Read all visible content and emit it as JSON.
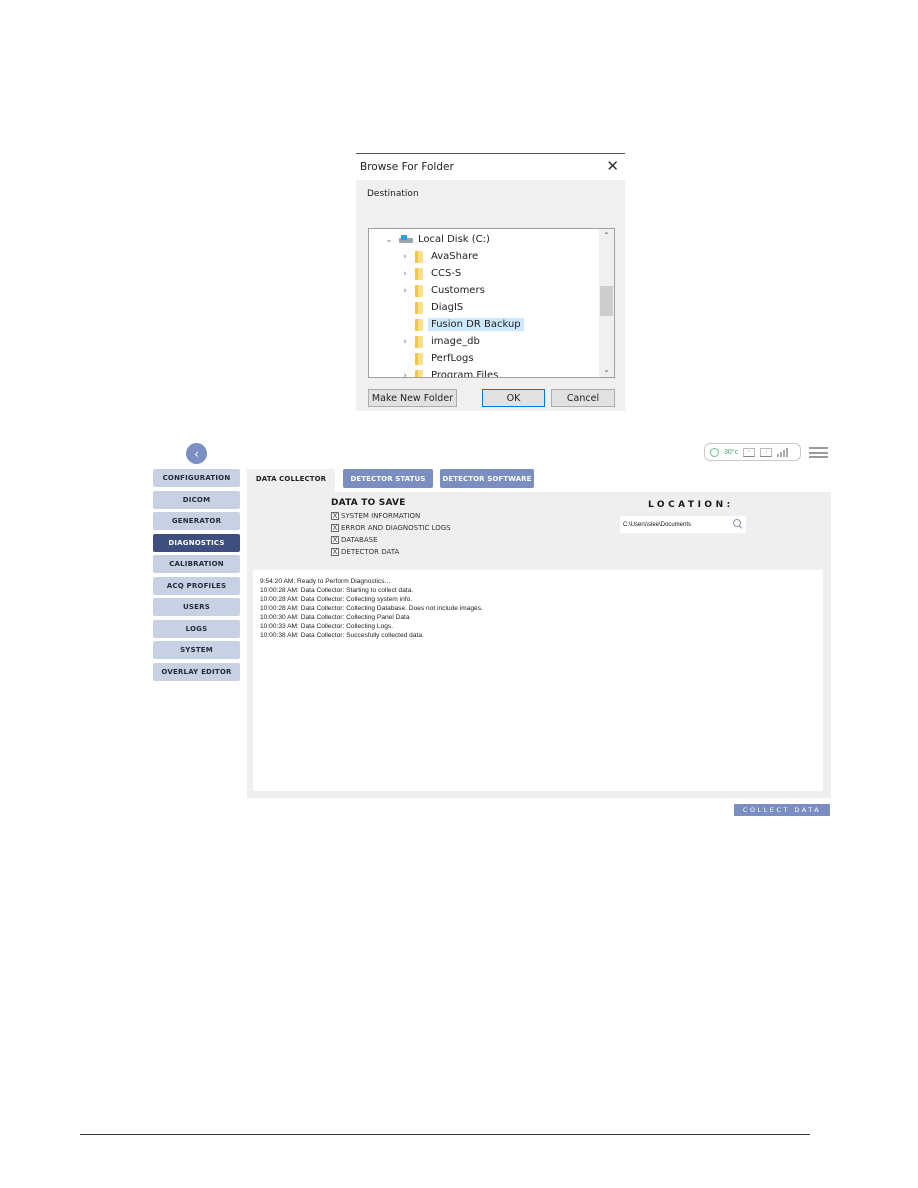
{
  "dialog": {
    "title": "Browse For Folder",
    "close_icon": "close-icon",
    "destination_label": "Destination",
    "tree": {
      "root": {
        "label": "Local Disk (C:)",
        "icon": "drive-icon",
        "expanded": true
      },
      "items": [
        {
          "label": "AvaShare",
          "expandable": true,
          "selected": false
        },
        {
          "label": "CCS-S",
          "expandable": true,
          "selected": false
        },
        {
          "label": "Customers",
          "expandable": true,
          "selected": false
        },
        {
          "label": "DiagIS",
          "expandable": false,
          "selected": false
        },
        {
          "label": "Fusion DR Backup",
          "expandable": false,
          "selected": true
        },
        {
          "label": "image_db",
          "expandable": true,
          "selected": false
        },
        {
          "label": "PerfLogs",
          "expandable": false,
          "selected": false
        },
        {
          "label": "Program Files",
          "expandable": true,
          "selected": false
        }
      ]
    },
    "buttons": {
      "make_new_folder": "Make New Folder",
      "ok": "OK",
      "cancel": "Cancel"
    }
  },
  "app": {
    "status": {
      "temperature": "30°c",
      "icons": [
        "status-ring-icon",
        "panel-icon",
        "download-icon",
        "signal-icon"
      ]
    },
    "sidebar": {
      "items": [
        {
          "label": "CONFIGURATION",
          "active": false
        },
        {
          "label": "DICOM",
          "active": false
        },
        {
          "label": "GENERATOR",
          "active": false
        },
        {
          "label": "DIAGNOSTICS",
          "active": true
        },
        {
          "label": "CALIBRATION",
          "active": false
        },
        {
          "label": "ACQ PROFILES",
          "active": false
        },
        {
          "label": "USERS",
          "active": false
        },
        {
          "label": "LOGS",
          "active": false
        },
        {
          "label": "SYSTEM",
          "active": false
        },
        {
          "label": "OVERLAY EDITOR",
          "active": false
        }
      ]
    },
    "tabs": [
      {
        "label": "DATA COLLECTOR",
        "active": true
      },
      {
        "label": "DETECTOR STATUS",
        "active": false
      },
      {
        "label": "DETECTOR SOFTWARE",
        "active": false
      }
    ],
    "data_to_save": {
      "title": "DATA TO SAVE",
      "options": [
        {
          "label": "SYSTEM INFORMATION",
          "checked": true
        },
        {
          "label": "ERROR AND DIAGNOSTIC LOGS",
          "checked": true
        },
        {
          "label": "DATABASE",
          "checked": true
        },
        {
          "label": "DETECTOR DATA",
          "checked": true
        }
      ],
      "check_mark": "X"
    },
    "location": {
      "title": "LOCATION:",
      "value": "C:\\Users\\slee\\Documents"
    },
    "log_lines": [
      "9:54:20 AM: Ready to Perform Diagnostics...",
      "10:00:28 AM: Data Collector: Starting to collect data.",
      "10:00:28 AM: Data Collector: Collecting system info.",
      "10:00:28 AM: Data Collector: Collecting Database.  Does not include images.",
      "10:00:30 AM: Data Collector: Collecting Panel Data",
      "10:00:33 AM: Data Collector: Collecting Logs.",
      "10:00:38 AM: Data Collector: Succesfully collected data."
    ],
    "collect_button": "COLLECT DATA",
    "colors": {
      "accent": "#7a8ec2",
      "active_nav": "#3e4f7f",
      "nav_inactive": "#c8d0e4",
      "status_green": "#3aa86a"
    }
  }
}
